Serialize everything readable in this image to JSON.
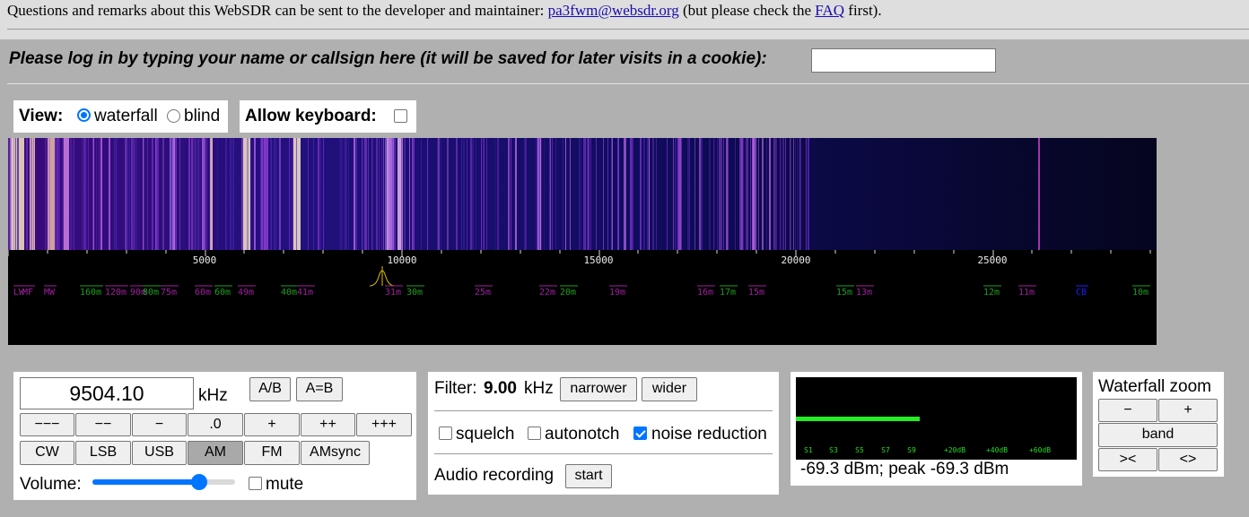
{
  "header": {
    "notice_before": "Questions and remarks about this WebSDR can be sent to the developer and maintainer: ",
    "email": "pa3fwm@websdr.org",
    "notice_middle": " (but please check the ",
    "faq": "FAQ",
    "notice_after": " first)."
  },
  "login": {
    "prompt": "Please log in by typing your name or callsign here (it will be saved for later visits in a cookie):",
    "value": ""
  },
  "view": {
    "label": "View:",
    "options": [
      "waterfall",
      "blind"
    ],
    "selected": "waterfall"
  },
  "keyboard": {
    "label": "Allow keyboard:",
    "checked": false
  },
  "scale": {
    "ticks": [
      "5000",
      "10000",
      "15000",
      "20000",
      "25000"
    ],
    "bands": [
      {
        "label": "LW",
        "color": "#a020a0"
      },
      {
        "label": "MF",
        "color": "#a020a0"
      },
      {
        "label": "MW",
        "color": "#a020a0"
      },
      {
        "label": "160m",
        "color": "#20a020"
      },
      {
        "label": "120m",
        "color": "#a020a0"
      },
      {
        "label": "90m",
        "color": "#a020a0"
      },
      {
        "label": "80m",
        "color": "#20a020"
      },
      {
        "label": "75m",
        "color": "#a020a0"
      },
      {
        "label": "60m",
        "color": "#a020a0"
      },
      {
        "label": "60m",
        "color": "#20a020"
      },
      {
        "label": "49m",
        "color": "#a020a0"
      },
      {
        "label": "40m",
        "color": "#20a020"
      },
      {
        "label": "41m",
        "color": "#a020a0"
      },
      {
        "label": "31m",
        "color": "#a020a0"
      },
      {
        "label": "30m",
        "color": "#20a020"
      },
      {
        "label": "25m",
        "color": "#a020a0"
      },
      {
        "label": "22m",
        "color": "#a020a0"
      },
      {
        "label": "20m",
        "color": "#20a020"
      },
      {
        "label": "19m",
        "color": "#a020a0"
      },
      {
        "label": "16m",
        "color": "#a020a0"
      },
      {
        "label": "17m",
        "color": "#20a020"
      },
      {
        "label": "15m",
        "color": "#a020a0"
      },
      {
        "label": "15m",
        "color": "#20a020"
      },
      {
        "label": "13m",
        "color": "#a020a0"
      },
      {
        "label": "12m",
        "color": "#20a020"
      },
      {
        "label": "11m",
        "color": "#a020a0"
      },
      {
        "label": "CB",
        "color": "#2020ff"
      },
      {
        "label": "10m",
        "color": "#20a020"
      }
    ]
  },
  "tuner": {
    "frequency": "9504.10",
    "unit": "kHz",
    "ab_label": "A/B",
    "aeqb_label": "A=B",
    "step_buttons": [
      "−−−",
      "−−",
      "−",
      ".0",
      "+",
      "++",
      "+++"
    ],
    "modes": [
      "CW",
      "LSB",
      "USB",
      "AM",
      "FM",
      "AMsync"
    ],
    "active_mode": "AM",
    "volume_label": "Volume:",
    "volume_level": 0.74,
    "mute_label": "mute",
    "mute_checked": false
  },
  "filter": {
    "label": "Filter:",
    "value": "9.00",
    "unit": "kHz",
    "narrower": "narrower",
    "wider": "wider",
    "squelch": "squelch",
    "autonotch": "autonotch",
    "noise_reduction": "noise reduction",
    "squelch_checked": false,
    "autonotch_checked": false,
    "noise_reduction_checked": true,
    "recording_label": "Audio recording",
    "start": "start"
  },
  "smeter": {
    "scale": [
      "S1",
      "S3",
      "S5",
      "S7",
      "S9",
      "+20dB",
      "+40dB",
      "+60dB"
    ],
    "level_fraction": 0.44,
    "readout": "-69.3 dBm; peak  -69.3 dBm"
  },
  "zoom": {
    "title": "Waterfall zoom",
    "minus": "−",
    "plus": "+",
    "band": "band",
    "narrow": "><",
    "widen": "<>"
  }
}
